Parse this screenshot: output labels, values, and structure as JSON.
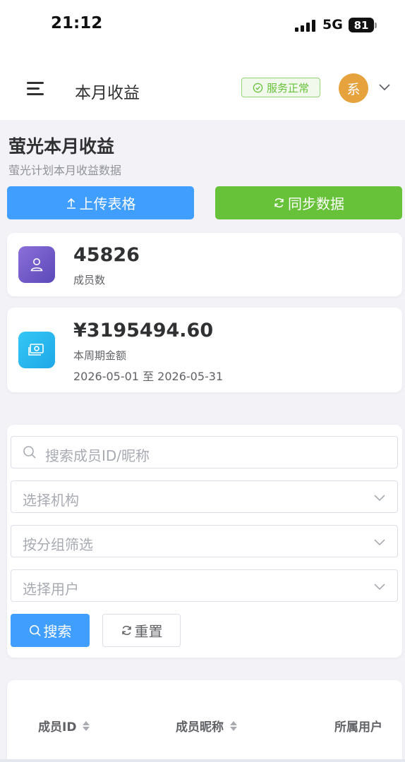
{
  "status_bar": {
    "time": "21:12",
    "network": "5G",
    "battery": "81"
  },
  "header": {
    "title": "本月收益",
    "service_status": "服务正常",
    "avatar_text": "系"
  },
  "section": {
    "title": "萤光本月收益",
    "subtitle": "萤光计划本月收益数据"
  },
  "actions": {
    "upload_label": "上传表格",
    "sync_label": "同步数据"
  },
  "stats": {
    "members": {
      "value": "45826",
      "label": "成员数"
    },
    "amount": {
      "value": "¥3195494.60",
      "label": "本周期金额",
      "range": "2026-05-01 至 2026-05-31"
    }
  },
  "filters": {
    "search_placeholder": "搜索成员ID/昵称",
    "org_placeholder": "选择机构",
    "group_placeholder": "按分组筛选",
    "user_placeholder": "选择用户",
    "search_button": "搜索",
    "reset_button": "重置"
  },
  "table": {
    "columns": [
      "成员ID",
      "成员昵称",
      "所属用户"
    ]
  },
  "colors": {
    "primary": "#409eff",
    "success": "#67c23a",
    "warning": "#e6a23c"
  }
}
